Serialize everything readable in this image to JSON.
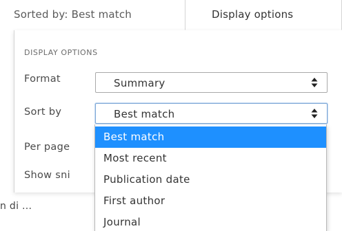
{
  "header": {
    "sorted_by_text": "Sorted by: Best match",
    "display_options_tab": "Display options"
  },
  "panel": {
    "heading": "DISPLAY OPTIONS",
    "format_label": "Format",
    "format_value": "Summary",
    "sort_label": "Sort by",
    "sort_value": "Best match",
    "per_page_label": "Per page",
    "show_snippets_label": "Show sni"
  },
  "dropdown": {
    "options": [
      "Best match",
      "Most recent",
      "Publication date",
      "First author",
      "Journal"
    ],
    "selected": "Best match"
  },
  "background": {
    "snippet_text": "n di ..."
  },
  "colors": {
    "selected_bg": "#1e90ff",
    "selected_text": "#ffffff",
    "focus_border": "#7fa8d6"
  },
  "icons": {
    "select_arrow": "up-down-arrows-icon"
  }
}
